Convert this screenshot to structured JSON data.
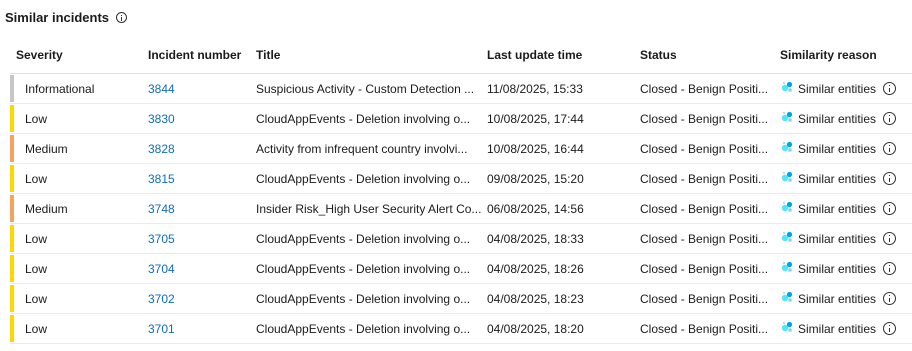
{
  "section": {
    "title": "Similar incidents",
    "info_icon": "info-icon"
  },
  "columns": [
    "Severity",
    "Incident number",
    "Title",
    "Last update time",
    "Status",
    "Similarity reason"
  ],
  "severity_colors": {
    "Informational": "#c8c6c4",
    "Low": "#ffd700",
    "Medium": "#f4a361"
  },
  "link_color": "#0f6cbd",
  "rows": [
    {
      "severity": "Informational",
      "number": "3844",
      "title": "Suspicious Activity - Custom Detection ...",
      "time": "11/08/2025, 15:33",
      "status": "Closed - Benign Positi...",
      "reason": "Similar entities",
      "reason_icon": "entities-icon"
    },
    {
      "severity": "Low",
      "number": "3830",
      "title": "CloudAppEvents - Deletion involving o...",
      "time": "10/08/2025, 17:44",
      "status": "Closed - Benign Positi...",
      "reason": "Similar entities",
      "reason_icon": "entities-icon"
    },
    {
      "severity": "Medium",
      "number": "3828",
      "title": "Activity from infrequent country involvi...",
      "time": "10/08/2025, 16:44",
      "status": "Closed - Benign Positi...",
      "reason": "Similar entities",
      "reason_icon": "entities-icon"
    },
    {
      "severity": "Low",
      "number": "3815",
      "title": "CloudAppEvents - Deletion involving o...",
      "time": "09/08/2025, 15:20",
      "status": "Closed - Benign Positi...",
      "reason": "Similar entities",
      "reason_icon": "entities-icon"
    },
    {
      "severity": "Medium",
      "number": "3748",
      "title": "Insider Risk_High User Security Alert Co...",
      "time": "06/08/2025, 14:56",
      "status": "Closed - Benign Positi...",
      "reason": "Similar entities",
      "reason_icon": "entities-icon"
    },
    {
      "severity": "Low",
      "number": "3705",
      "title": "CloudAppEvents - Deletion involving o...",
      "time": "04/08/2025, 18:33",
      "status": "Closed - Benign Positi...",
      "reason": "Similar entities",
      "reason_icon": "entities-icon"
    },
    {
      "severity": "Low",
      "number": "3704",
      "title": "CloudAppEvents - Deletion involving o...",
      "time": "04/08/2025, 18:26",
      "status": "Closed - Benign Positi...",
      "reason": "Similar entities",
      "reason_icon": "entities-icon"
    },
    {
      "severity": "Low",
      "number": "3702",
      "title": "CloudAppEvents - Deletion involving o...",
      "time": "04/08/2025, 18:23",
      "status": "Closed - Benign Positi...",
      "reason": "Similar entities",
      "reason_icon": "entities-icon"
    },
    {
      "severity": "Low",
      "number": "3701",
      "title": "CloudAppEvents - Deletion involving o...",
      "time": "04/08/2025, 18:20",
      "status": "Closed - Benign Positi...",
      "reason": "Similar entities",
      "reason_icon": "entities-icon"
    }
  ]
}
